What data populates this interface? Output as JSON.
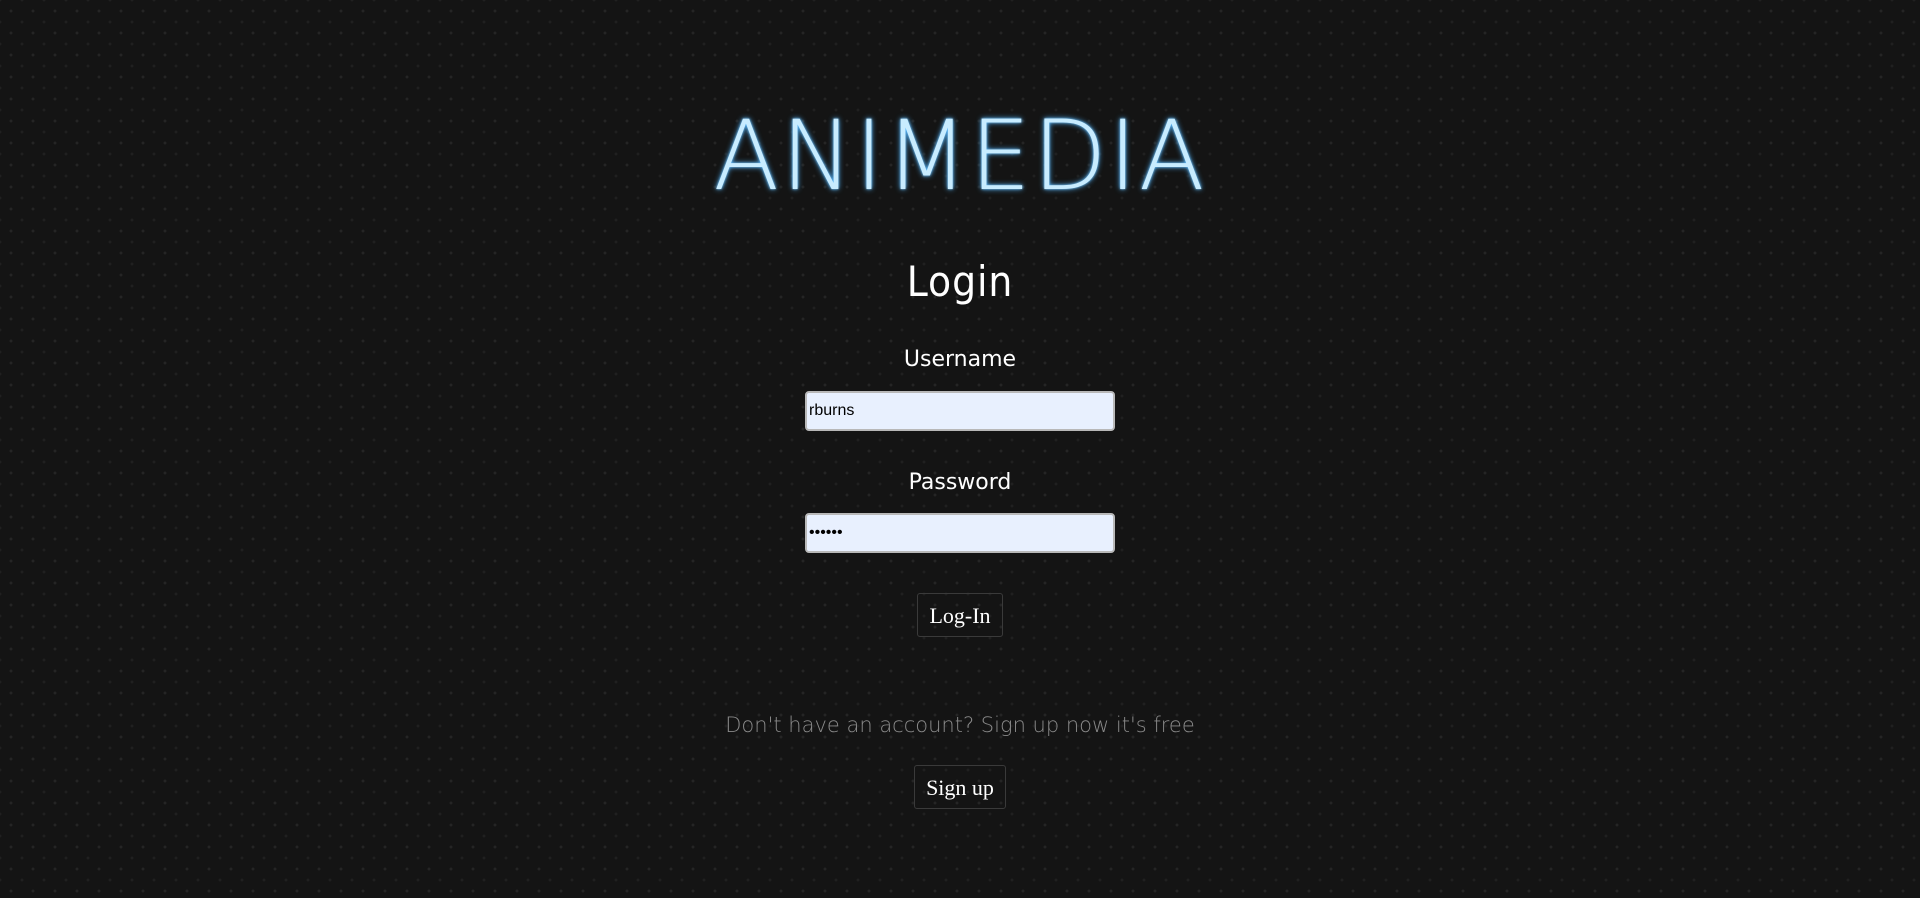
{
  "brand": {
    "name": "ANIMEDIA"
  },
  "login_form": {
    "title": "Login",
    "username_label": "Username",
    "username_value": "rburns",
    "password_label": "Password",
    "password_value": "rburns",
    "submit_label": "Log-In"
  },
  "signup": {
    "prompt": "Don't have an account? Sign up now it's free",
    "button_label": "Sign up"
  },
  "colors": {
    "background": "#141414",
    "brand_glow": "#4fb4ff",
    "input_background": "#e8f0fe"
  }
}
